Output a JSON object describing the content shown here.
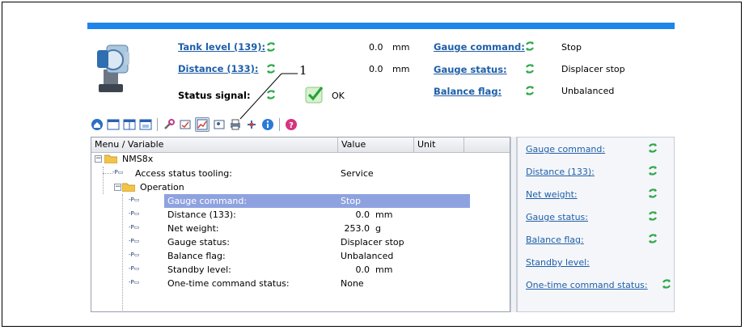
{
  "header": {
    "tank_level_label": "Tank level (139):",
    "tank_level_value": "0.0",
    "tank_level_unit": "mm",
    "distance_label": "Distance (133):",
    "distance_value": "0.0",
    "distance_unit": "mm",
    "status_signal_label": "Status signal:",
    "status_signal_value": "OK",
    "gauge_command_label": "Gauge command:",
    "gauge_command_value": "Stop",
    "gauge_status_label": "Gauge status:",
    "gauge_status_value": "Displacer stop",
    "balance_flag_label": "Balance flag:",
    "balance_flag_value": "Unbalanced"
  },
  "callout": "1",
  "toolbar": {
    "icons": [
      "home-icon",
      "view-icon",
      "view-split-icon",
      "view-window-icon",
      "wrench-icon",
      "form-icon",
      "chart-icon",
      "profile-icon",
      "print-icon",
      "connect-icon",
      "info-icon",
      "help-icon"
    ]
  },
  "grid": {
    "columns": [
      "Menu / Variable",
      "Value",
      "Unit"
    ],
    "device": "NMS8x",
    "access_status_label": "Access status tooling:",
    "access_status_value": "Service",
    "operation_label": "Operation",
    "rows": [
      {
        "name": "Gauge command:",
        "value": "Stop",
        "num": "",
        "unit": ""
      },
      {
        "name": "Distance (133):",
        "value": "",
        "num": "0.0",
        "unit": "mm"
      },
      {
        "name": "Net weight:",
        "value": "",
        "num": "253.0",
        "unit": "g"
      },
      {
        "name": "Gauge status:",
        "value": "Displacer stop",
        "num": "",
        "unit": ""
      },
      {
        "name": "Balance flag:",
        "value": "Unbalanced",
        "num": "",
        "unit": ""
      },
      {
        "name": "Standby level:",
        "value": "",
        "num": "0.0",
        "unit": "mm"
      },
      {
        "name": "One-time command status:",
        "value": "None",
        "num": "",
        "unit": ""
      }
    ]
  },
  "right_panel": {
    "items": [
      "Gauge command:",
      "Distance (133):",
      "Net weight:",
      "Gauge status:",
      "Balance flag:",
      "Standby level:",
      "One-time command status:"
    ]
  },
  "colors": {
    "title_bar": "#1e86e8",
    "link": "#1f5fa8",
    "selection": "#8fa2e0",
    "refresh_green": "#2ea84a"
  }
}
